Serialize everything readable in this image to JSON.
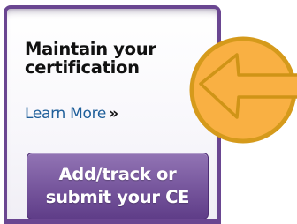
{
  "card": {
    "title": "Maintain your certification",
    "learn_more_label": "Learn More",
    "learn_more_arrow": "»",
    "cta_line1": "Add/track or",
    "cta_line2": "submit your CE"
  },
  "arrow_badge": {
    "icon": "left-arrow-icon"
  },
  "colors": {
    "card_border": "#6a4691",
    "link": "#1f5f9a",
    "button_top": "#9274b4",
    "button_bottom": "#5f3d88",
    "badge_fill": "#f9b043",
    "badge_ring": "#d59a1b"
  }
}
